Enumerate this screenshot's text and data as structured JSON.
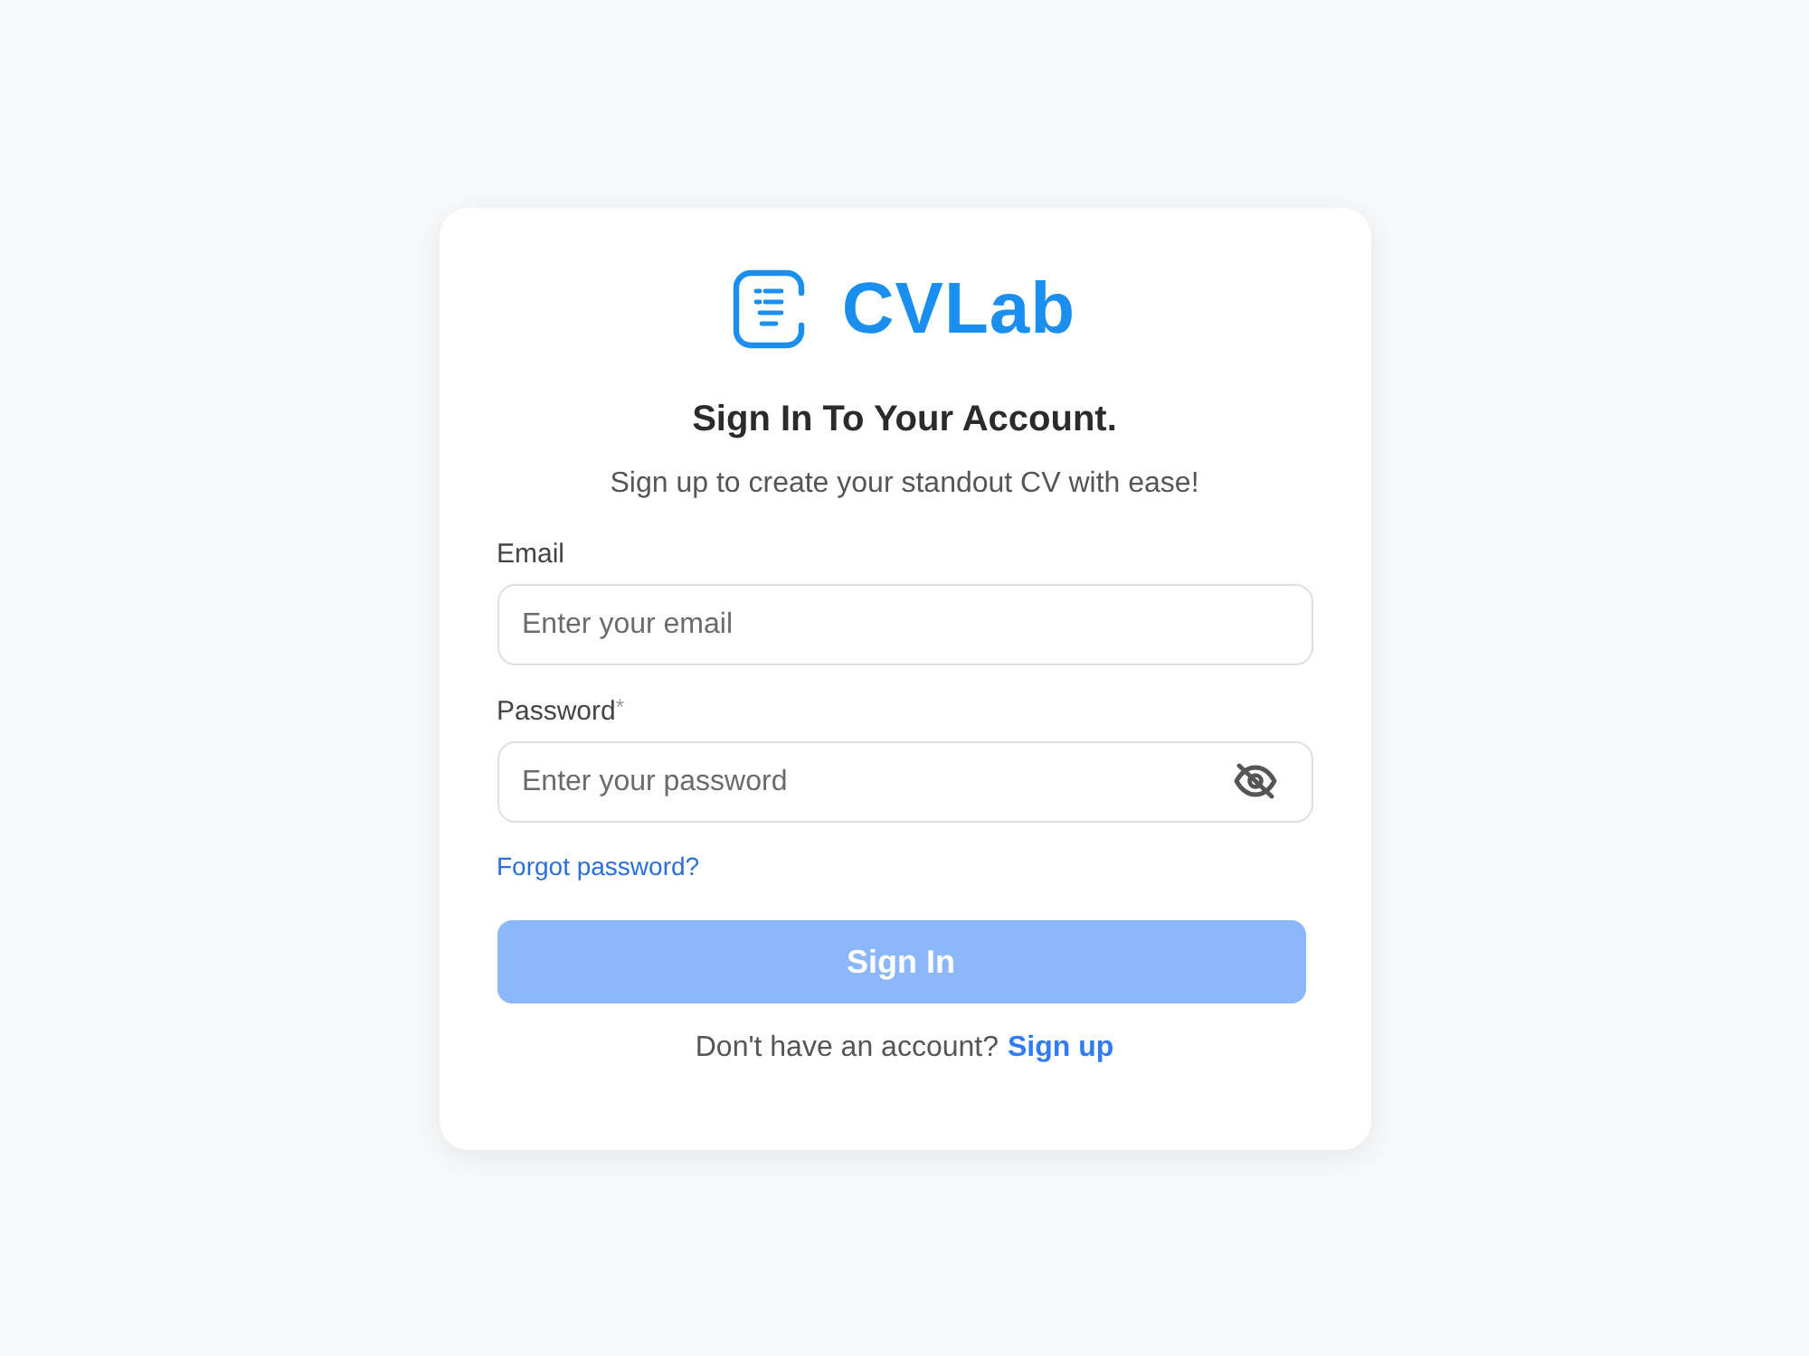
{
  "logo": {
    "wordmark": "CVLab"
  },
  "heading": {
    "title": "Sign In To Your Account.",
    "subtitle": "Sign up to create your standout CV with ease!"
  },
  "fields": [
    {
      "kind": "email",
      "label": "Email",
      "placeholder": "Enter your email"
    },
    {
      "kind": "password",
      "label": "Password",
      "required_mark": "*",
      "placeholder": "Enter your password",
      "password_visible": false
    }
  ],
  "forgot_link": "Forgot password?",
  "submit": {
    "label": "Sign In",
    "disabled": true
  },
  "footer": {
    "prompt": "Don't have an account?",
    "link": "Sign up"
  }
}
